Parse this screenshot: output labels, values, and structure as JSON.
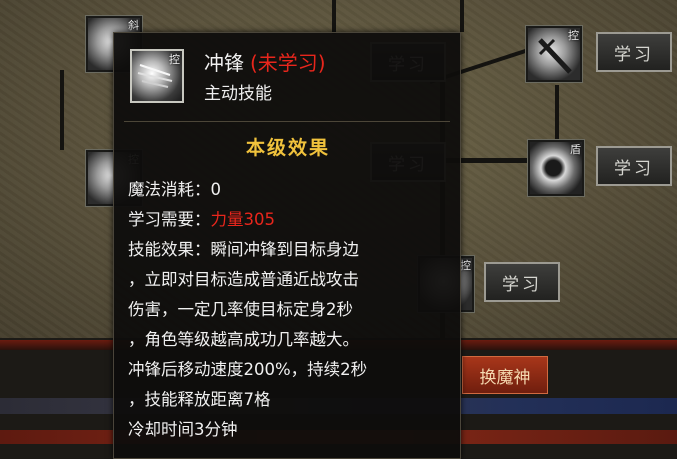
{
  "tooltip": {
    "skill_name": "冲锋",
    "learn_status": "(未学习)",
    "skill_type": "主动技能",
    "icon_tag": "控",
    "section_title": "本级效果",
    "mana_cost_label": "魔法消耗：",
    "mana_cost_value": "0",
    "requirement_label": "学习需要：",
    "requirement_value": "力量305",
    "effect_lines": [
      "技能效果：瞬间冲锋到目标身边",
      "，立即对目标造成普通近战攻击",
      "伤害，一定几率使目标定身2秒",
      "，角色等级越高成功几率越大。",
      "冲锋后移动速度200%，持续2秒",
      "，技能释放距离7格",
      "冷却时间3分钟"
    ]
  },
  "skill_tree": {
    "learn_label": "学习",
    "node_tags": [
      "斜",
      "控",
      "控",
      "盾",
      "控"
    ],
    "node_icons": [
      "feather-icon",
      "crossed-swords-icon",
      "blade-flurry-icon",
      "shield-ring-icon",
      "slash-icon"
    ]
  },
  "bottom": {
    "summon_label": "换魔神"
  },
  "colors": {
    "gold": "#f0c23c",
    "red": "#e8261c",
    "panel": "#5a523c"
  }
}
